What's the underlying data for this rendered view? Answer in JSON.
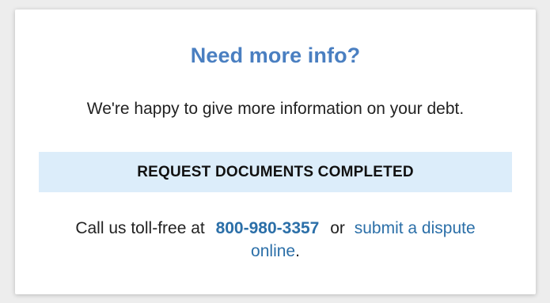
{
  "card": {
    "title": "Need more info?",
    "subtitle": "We're happy to give more information on your debt.",
    "status": "REQUEST DOCUMENTS COMPLETED",
    "contact": {
      "prefix": "Call us toll-free at",
      "phone": "800-980-3357",
      "or": "or",
      "dispute_link_line1": "submit a dispute",
      "dispute_link_line2": "online",
      "suffix": "."
    }
  },
  "colors": {
    "title": "#4a7fc1",
    "link": "#2b6fa8",
    "status_bg": "#dcedfa",
    "page_bg": "#ededed"
  }
}
